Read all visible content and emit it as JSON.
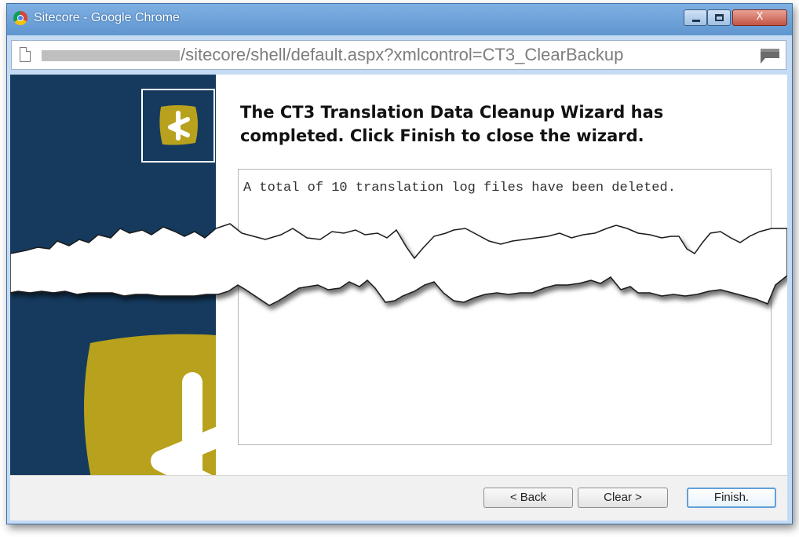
{
  "window": {
    "title": "Sitecore - Google Chrome",
    "close_glyph": "X",
    "minimize_icon": "minimize-icon",
    "maximize_icon": "maximize-icon"
  },
  "address_bar": {
    "url": "/sitecore/shell/default.aspx?xmlcontrol=CT3_ClearBackup",
    "page_icon": "page-icon",
    "extension_icon": "flag-icon"
  },
  "wizard": {
    "heading": "The CT3 Translation Data Cleanup Wizard has completed. Click Finish to close the wizard.",
    "message": "A total of 10 translation log files have been deleted.",
    "logo_icon": "sitecore-logo-icon",
    "colors": {
      "panel": "#153a5e",
      "logo_gold": "#b8a11c",
      "title_bar": "#6ea2d8"
    }
  },
  "buttons": {
    "back": "< Back",
    "clear": "Clear >",
    "finish": "Finish."
  }
}
